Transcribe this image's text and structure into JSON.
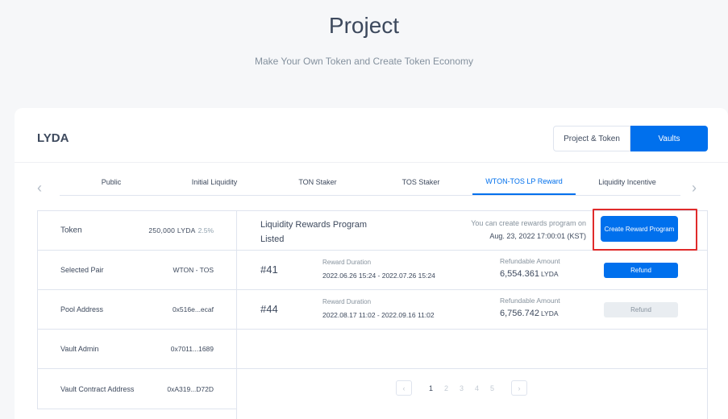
{
  "header": {
    "title": "Project",
    "subtitle": "Make Your Own Token and Create Token Economy"
  },
  "project": {
    "name": "LYDA",
    "toggle": {
      "left": "Project & Token",
      "right": "Vaults",
      "active": "Vaults"
    }
  },
  "tabs": [
    {
      "label": "Public"
    },
    {
      "label": "Initial Liquidity"
    },
    {
      "label": "TON Staker"
    },
    {
      "label": "TOS Staker"
    },
    {
      "label": "WTON-TOS LP Reward",
      "active": true
    },
    {
      "label": "Liquidity Incentive"
    }
  ],
  "info": {
    "token_label": "Token",
    "token_amount": "250,000 LYDA",
    "token_pct": "2.5%",
    "rows": [
      {
        "label": "Selected Pair",
        "value": "WTON - TOS"
      },
      {
        "label": "Pool Address",
        "value": "0x516e...ecaf"
      },
      {
        "label": "Vault Admin",
        "value": "0x7011...1689"
      },
      {
        "label": "Vault Contract Address",
        "value": "0xA319...D72D"
      }
    ]
  },
  "rewards": {
    "title": "Liquidity Rewards Program Listed",
    "note": "You can create rewards program on",
    "date": "Aug. 23, 2022 17:00:01 (KST)",
    "create_button": "Create Reward Program",
    "duration_label": "Reward Duration",
    "amount_label": "Refundable Amount",
    "programs": [
      {
        "id": "#41",
        "duration": "2022.06.26 15:24 - 2022.07.26 15:24",
        "amount": "6,554.361",
        "unit": "LYDA",
        "refund": "Refund",
        "enabled": true
      },
      {
        "id": "#44",
        "duration": "2022.08.17 11:02 - 2022.09.16 11:02",
        "amount": "6,756.742",
        "unit": "LYDA",
        "refund": "Refund",
        "enabled": false
      }
    ]
  },
  "pagination": {
    "pages": [
      "1",
      "2",
      "3",
      "4",
      "5"
    ],
    "current": "1"
  },
  "colors": {
    "accent": "#0070ed",
    "highlight": "#e02b2b",
    "text": "#3d495d",
    "muted": "#86929d"
  }
}
